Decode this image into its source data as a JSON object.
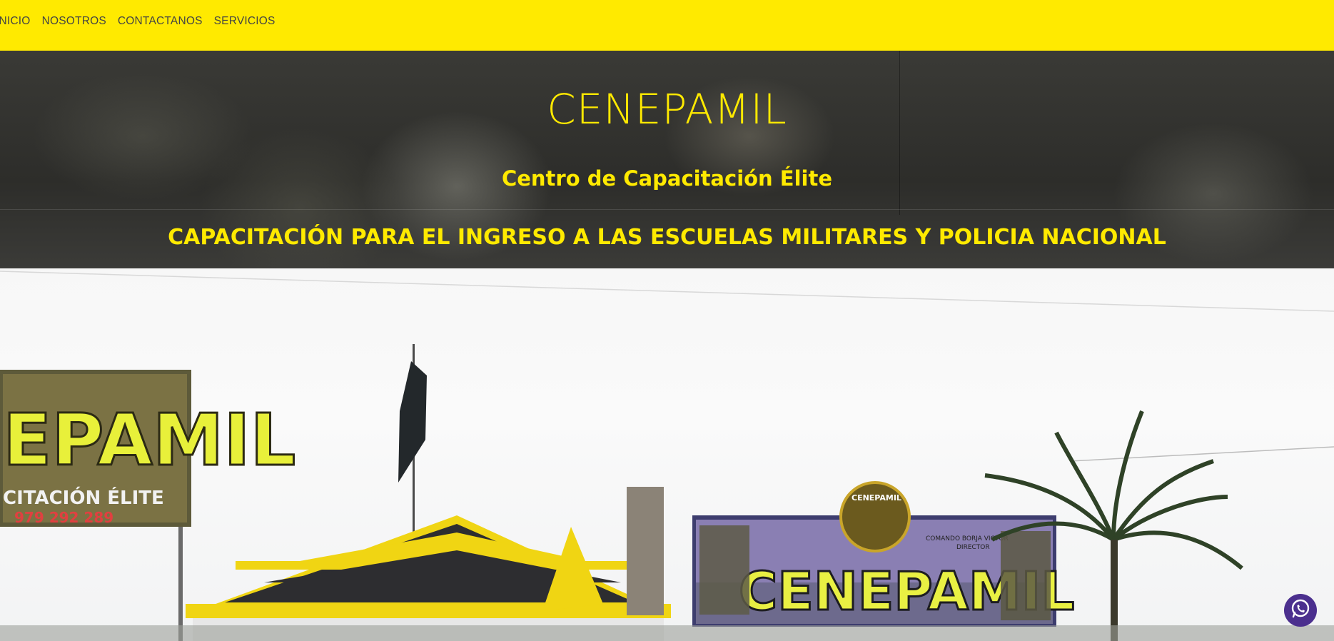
{
  "nav": {
    "items": [
      {
        "label": "INICIO"
      },
      {
        "label": "NOSOTROS"
      },
      {
        "label": "CONTACTANOS"
      },
      {
        "label": "SERVICIOS"
      }
    ]
  },
  "hero": {
    "title": "CENEPAMIL",
    "subtitle": "Centro de Capacitación Élite",
    "tagline": "CAPACITACIÓN PARA EL INGRESO A LAS ESCUELAS MILITARES Y POLICIA NACIONAL"
  },
  "photo": {
    "left_sign_text": "EPAMIL",
    "left_sign_sub": "CITACIÓN ÉLITE",
    "left_sign_phone": "979 292 289",
    "right_sign_text": "CENEPAMIL",
    "right_sign_badge": "CENEPAMIL",
    "right_sign_caption_1": "COMANDO BORJA VICTOR",
    "right_sign_caption_2": "DIRECTOR"
  },
  "colors": {
    "accent": "#ffea00",
    "nav_text": "#444444",
    "whatsapp": "#4b2f8e"
  },
  "icons": {
    "whatsapp": "whatsapp-icon"
  }
}
